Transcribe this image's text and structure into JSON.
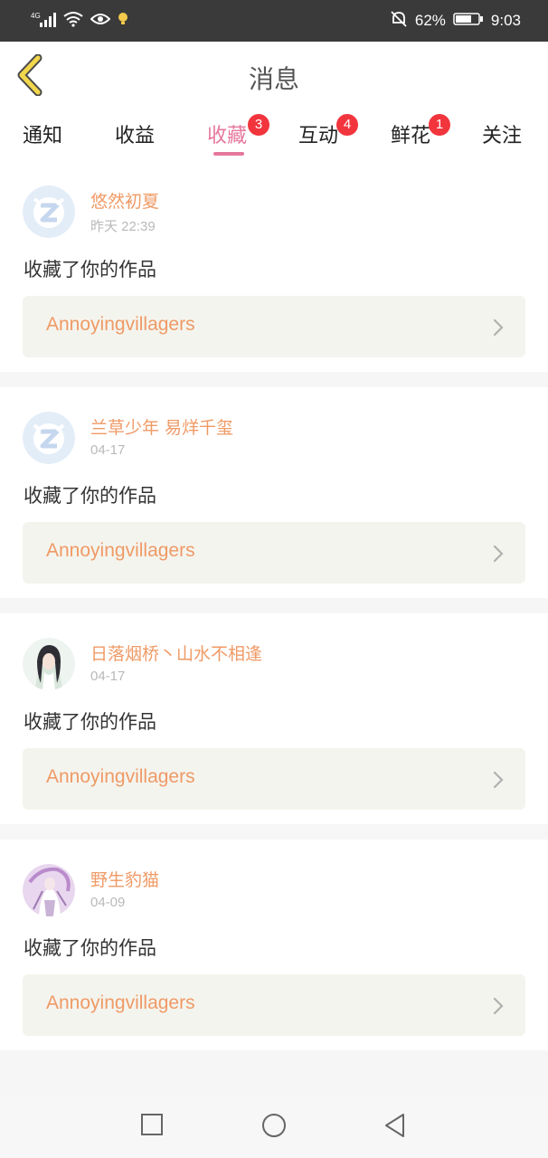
{
  "status_bar": {
    "network": "4G",
    "battery_percent": "62%",
    "time": "9:03",
    "icons": [
      "signal-icon",
      "wifi-icon",
      "eye-icon",
      "bulb-icon",
      "mute-icon",
      "battery-icon"
    ]
  },
  "header": {
    "title": "消息"
  },
  "tabs": [
    {
      "label": "通知",
      "badge": ""
    },
    {
      "label": "收益",
      "badge": ""
    },
    {
      "label": "收藏",
      "badge": "3",
      "active": true
    },
    {
      "label": "互动",
      "badge": "4"
    },
    {
      "label": "鲜花",
      "badge": "1"
    },
    {
      "label": "关注",
      "badge": ""
    }
  ],
  "notifications": [
    {
      "user": "悠然初夏",
      "time": "昨天 22:39",
      "action": "收藏了你的作品",
      "work": "Annoyingvillagers",
      "avatar": "default-z-avatar"
    },
    {
      "user": "兰草少年 易烊千玺",
      "time": "04-17",
      "action": "收藏了你的作品",
      "work": "Annoyingvillagers",
      "avatar": "default-z-avatar"
    },
    {
      "user": "日落烟桥丶山水不相逢",
      "time": "04-17",
      "action": "收藏了你的作品",
      "work": "Annoyingvillagers",
      "avatar": "illustrated-girl-avatar"
    },
    {
      "user": "野生豹猫",
      "time": "04-09",
      "action": "收藏了你的作品",
      "work": "Annoyingvillagers",
      "avatar": "illustrated-purple-avatar"
    }
  ],
  "colors": {
    "accent_pink": "#e6779e",
    "username_orange": "#ef9a66",
    "badge_red": "#f2353d",
    "back_arrow_yellow": "#f2d64b"
  }
}
